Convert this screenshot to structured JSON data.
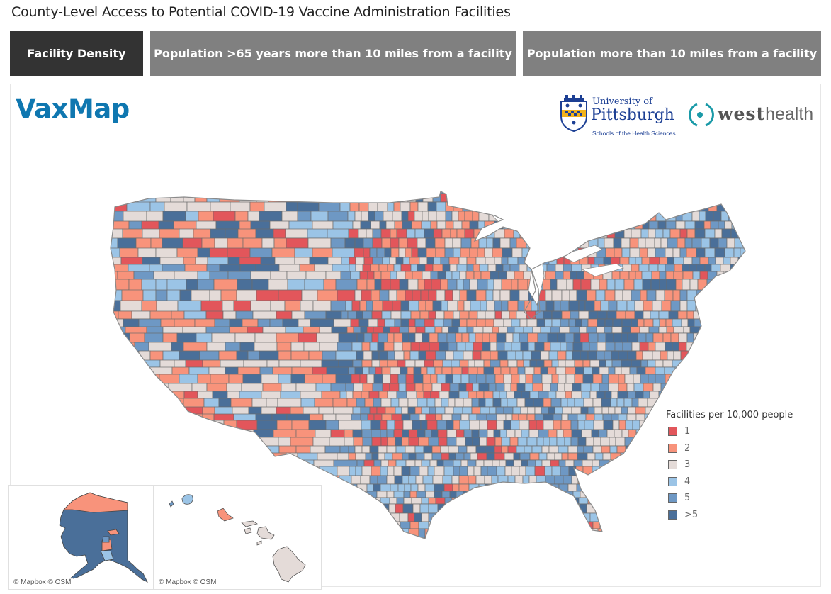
{
  "title": "County-Level Access to Potential COVID-19 Vaccine Administration Facilities",
  "tabs": [
    {
      "label": "Facility Density",
      "active": true
    },
    {
      "label": "Population >65 years more than 10 miles from a facility",
      "active": false
    },
    {
      "label": "Population more than 10 miles from a facility",
      "active": false
    }
  ],
  "brand": "VaxMap",
  "logos": {
    "pitt_line1": "University of",
    "pitt_line2": "Pittsburgh",
    "pitt_line3": "Schools of the Health Sciences",
    "westhealth_bold": "west",
    "westhealth_light": "health"
  },
  "legend": {
    "title": "Facilities per 10,000 people",
    "items": [
      {
        "label": "1",
        "color": "#e2565b"
      },
      {
        "label": "2",
        "color": "#f8937b"
      },
      {
        "label": "3",
        "color": "#e4dbd8"
      },
      {
        "label": "4",
        "color": "#9bc4e6"
      },
      {
        "label": "5",
        "color": "#6e98c4"
      },
      {
        "label": ">5",
        "color": "#4a6f99"
      }
    ]
  },
  "insets": {
    "alaska_credit": "© Mapbox © OSM",
    "hawaii_credit": "© Mapbox © OSM"
  },
  "chart_data": {
    "type": "choropleth",
    "title": "County-Level Access to Potential COVID-19 Vaccine Administration Facilities",
    "measure": "Facilities per 10,000 people",
    "classes": [
      "1",
      "2",
      "3",
      "4",
      "5",
      ">5"
    ],
    "regions": {
      "alaska": "mostly >5, northern borough 2",
      "hawaii": {
        "kauai": "4",
        "oahu": "2",
        "maui": "3",
        "hawaii_island": "3"
      },
      "appalachia": "mostly >5",
      "maine": "mostly >5",
      "great_plains": "mix of 1 and 2",
      "southwest": "mostly 2 and 3"
    }
  }
}
